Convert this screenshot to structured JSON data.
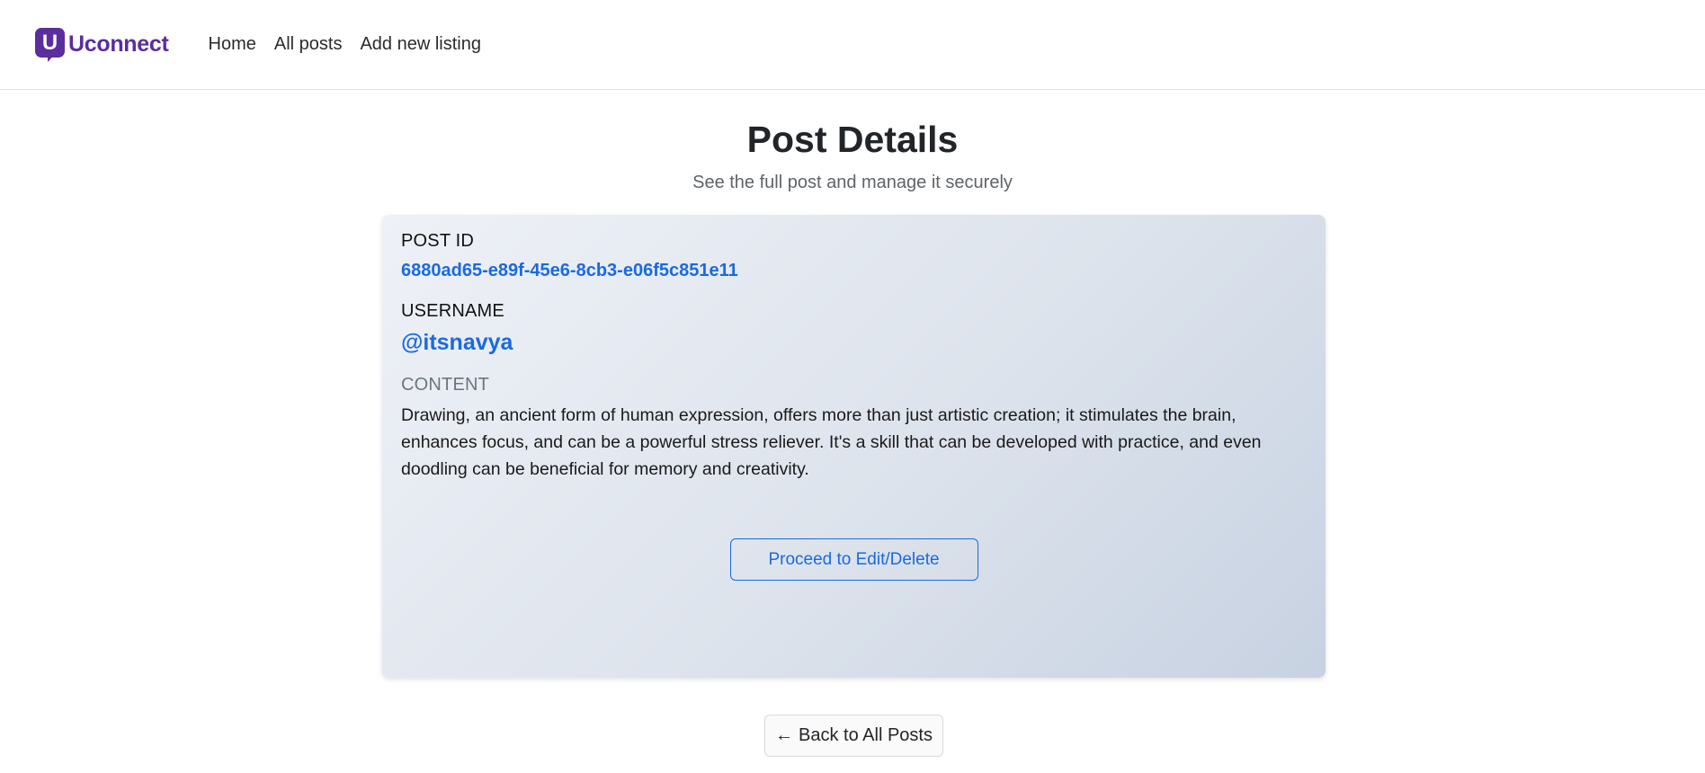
{
  "brand": {
    "letter": "U",
    "name": "Uconnect",
    "color": "#5b2d9e"
  },
  "nav": {
    "items": [
      {
        "label": "Home"
      },
      {
        "label": "All posts"
      },
      {
        "label": "Add new listing"
      }
    ]
  },
  "header": {
    "title": "Post Details",
    "subtitle": "See the full post and manage it securely"
  },
  "post": {
    "id_label": "POST ID",
    "id": "6880ad65-e89f-45e6-8cb3-e06f5c851e11",
    "username_label": "USERNAME",
    "username": "@itsnavya",
    "content_label": "CONTENT",
    "content": "Drawing, an ancient form of human expression, offers more than just artistic creation; it stimulates the brain, enhances focus, and can be a powerful stress reliever. It's a skill that can be developed with practice, and even doodling can be beneficial for memory and creativity."
  },
  "actions": {
    "edit_label": "Proceed to Edit/Delete",
    "back_arrow": "←",
    "back_label": "Back to All Posts"
  },
  "colors": {
    "accent": "#1a6ae0",
    "brand": "#5b2d9e"
  }
}
